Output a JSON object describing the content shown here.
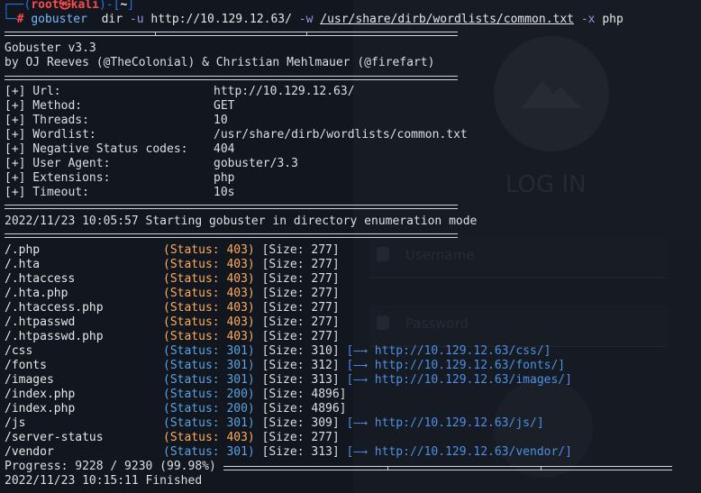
{
  "prompt": {
    "user": "root",
    "at": "㉿",
    "host": "kali",
    "dir": "~",
    "command": "gobuster",
    "subcommand": "dir",
    "flag_u": "-u",
    "url": "http://10.129.12.63/",
    "flag_w": "-w",
    "wordlist": "/usr/share/dirb/wordlists/common.txt",
    "flag_x": "-x",
    "ext": "php"
  },
  "banner": {
    "title": "Gobuster v3.3",
    "authors": "by OJ Reeves (@TheColonial) & Christian Mehlmauer (@firefart)"
  },
  "config": [
    {
      "key": "[+] Url:",
      "value": "http://10.129.12.63/"
    },
    {
      "key": "[+] Method:",
      "value": "GET"
    },
    {
      "key": "[+] Threads:",
      "value": "10"
    },
    {
      "key": "[+] Wordlist:",
      "value": "/usr/share/dirb/wordlists/common.txt"
    },
    {
      "key": "[+] Negative Status codes:",
      "value": "404"
    },
    {
      "key": "[+] User Agent:",
      "value": "gobuster/3.3"
    },
    {
      "key": "[+] Extensions:",
      "value": "php"
    },
    {
      "key": "[+] Timeout:",
      "value": "10s"
    }
  ],
  "start_line": "2022/11/23 10:05:57 Starting gobuster in directory enumeration mode",
  "results": [
    {
      "path": "/.php",
      "status": "(Status: 403)",
      "size": "[Size: 277]",
      "redirect": ""
    },
    {
      "path": "/.hta",
      "status": "(Status: 403)",
      "size": "[Size: 277]",
      "redirect": ""
    },
    {
      "path": "/.htaccess",
      "status": "(Status: 403)",
      "size": "[Size: 277]",
      "redirect": ""
    },
    {
      "path": "/.hta.php",
      "status": "(Status: 403)",
      "size": "[Size: 277]",
      "redirect": ""
    },
    {
      "path": "/.htaccess.php",
      "status": "(Status: 403)",
      "size": "[Size: 277]",
      "redirect": ""
    },
    {
      "path": "/.htpasswd",
      "status": "(Status: 403)",
      "size": "[Size: 277]",
      "redirect": ""
    },
    {
      "path": "/.htpasswd.php",
      "status": "(Status: 403)",
      "size": "[Size: 277]",
      "redirect": ""
    },
    {
      "path": "/css",
      "status": "(Status: 301)",
      "size": "[Size: 310]",
      "redirect": "[—→ http://10.129.12.63/css/]"
    },
    {
      "path": "/fonts",
      "status": "(Status: 301)",
      "size": "[Size: 312]",
      "redirect": "[—→ http://10.129.12.63/fonts/]"
    },
    {
      "path": "/images",
      "status": "(Status: 301)",
      "size": "[Size: 313]",
      "redirect": "[—→ http://10.129.12.63/images/]"
    },
    {
      "path": "/index.php",
      "status": "(Status: 200)",
      "size": "[Size: 4896]",
      "redirect": ""
    },
    {
      "path": "/index.php",
      "status": "(Status: 200)",
      "size": "[Size: 4896]",
      "redirect": ""
    },
    {
      "path": "/js",
      "status": "(Status: 301)",
      "size": "[Size: 309]",
      "redirect": "[—→ http://10.129.12.63/js/]"
    },
    {
      "path": "/server-status",
      "status": "(Status: 403)",
      "size": "[Size: 277]",
      "redirect": ""
    },
    {
      "path": "/vendor",
      "status": "(Status: 301)",
      "size": "[Size: 313]",
      "redirect": "[—→ http://10.129.12.63/vendor/]"
    }
  ],
  "progress": "Progress: 9228 / 9230 (99.98%)",
  "finished": "2022/11/23 10:15:11 Finished",
  "background": {
    "login_title": "LOG IN",
    "username_placeholder": "Username",
    "password_placeholder": "Password"
  },
  "colors": {
    "status_403": "#ffad5c",
    "status_301": "#5aa3e0",
    "status_200": "#5aa3e0",
    "redirect": "#4d90e6",
    "prompt_user": "#ff4a4a",
    "prompt_frame": "#2f6fe0"
  }
}
